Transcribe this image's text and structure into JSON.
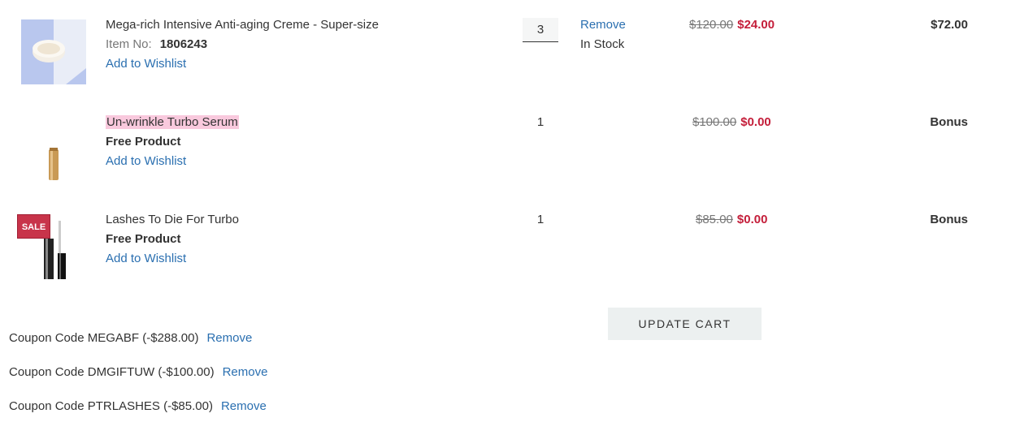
{
  "cart": {
    "items": [
      {
        "name": "Mega-rich Intensive Anti-aging Creme - Super-size",
        "item_no_label": "Item No:",
        "item_no": "1806243",
        "wishlist": "Add to Wishlist",
        "qty": "3",
        "remove": "Remove",
        "stock": "In Stock",
        "was_price": "$120.00",
        "now_price": "$24.00",
        "total": "$72.00"
      },
      {
        "name": "Un-wrinkle Turbo Serum",
        "free_label": "Free Product",
        "wishlist": "Add to Wishlist",
        "qty": "1",
        "was_price": "$100.00",
        "now_price": "$0.00",
        "total": "Bonus"
      },
      {
        "name": "Lashes To Die For Turbo",
        "free_label": "Free Product",
        "wishlist": "Add to Wishlist",
        "qty": "1",
        "was_price": "$85.00",
        "now_price": "$0.00",
        "total": "Bonus",
        "badge": "SALE"
      }
    ],
    "update_button": "UPDATE CART",
    "coupons": [
      {
        "text": "Coupon Code MEGABF (-$288.00)",
        "remove": "Remove"
      },
      {
        "text": "Coupon Code DMGIFTUW (-$100.00)",
        "remove": "Remove"
      },
      {
        "text": "Coupon Code PTRLASHES (-$85.00)",
        "remove": "Remove"
      }
    ]
  },
  "colors": {
    "link": "#2a6fb0",
    "sale_price": "#c41e3a",
    "highlight": "#f9c9dd",
    "sale_badge": "#c8344a",
    "button_bg": "#ecf0f0"
  },
  "icons": [
    "creme-jar-image",
    "serum-bottle-image",
    "mascara-image"
  ]
}
